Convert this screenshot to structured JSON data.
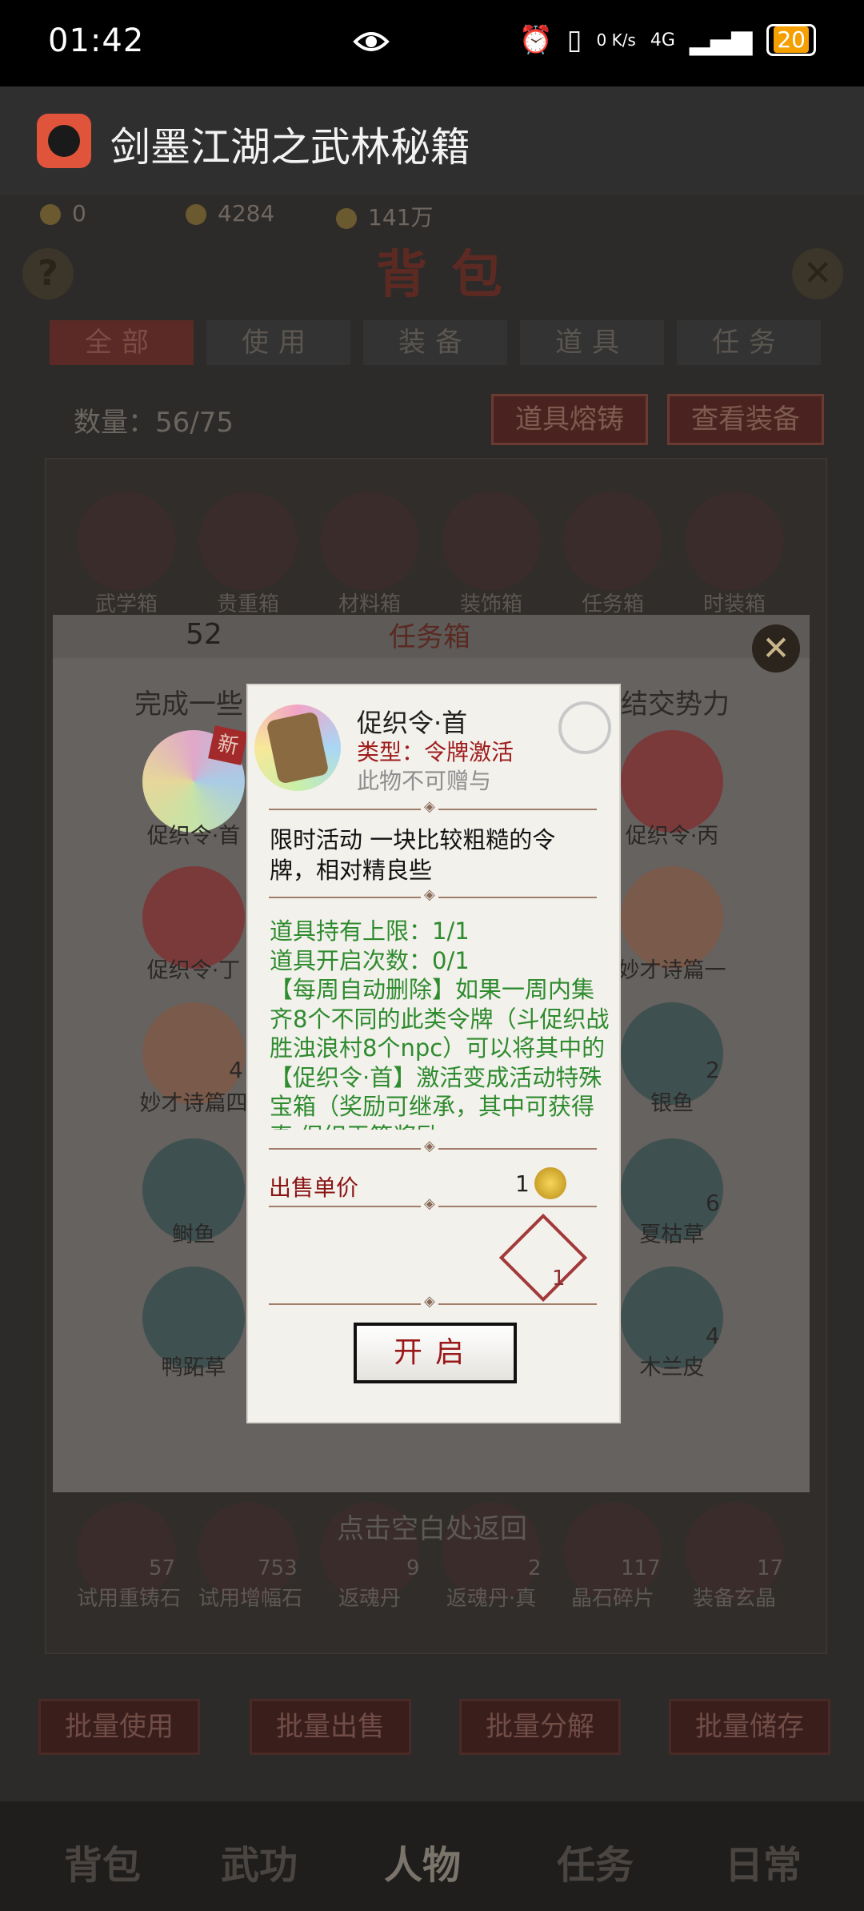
{
  "status_bar": {
    "time": "01:42",
    "net_speed": "0 K/s",
    "network": "4G",
    "battery": "20"
  },
  "app": {
    "title": "剑墨江湖之武林秘籍"
  },
  "resources": [
    "0",
    "4284",
    "141万"
  ],
  "bag": {
    "title": "背包",
    "tabs": [
      "全部",
      "使用",
      "装备",
      "道具",
      "任务"
    ],
    "count_text": "数量：56/75",
    "top_buttons": [
      "道具熔铸",
      "查看装备"
    ],
    "row1": [
      "武学箱",
      "贵重箱",
      "材料箱",
      "装饰箱",
      "任务箱",
      "时装箱"
    ],
    "row_bottom": [
      {
        "name": "试用重铸石",
        "count": "57"
      },
      {
        "name": "试用增幅石",
        "count": "753"
      },
      {
        "name": "返魂丹",
        "count": "9"
      },
      {
        "name": "返魂丹·真",
        "count": "2"
      },
      {
        "name": "晶石碎片",
        "count": "117"
      },
      {
        "name": "装备玄晶",
        "count": "17"
      }
    ],
    "batch_buttons": [
      "批量使用",
      "批量出售",
      "批量分解",
      "批量储存"
    ]
  },
  "nav": [
    "背包",
    "武功",
    "人物",
    "任务",
    "日常"
  ],
  "task_box": {
    "count": "52",
    "title": "任务箱",
    "desc_left": "完成一些",
    "desc_right": "结交势力",
    "items_left": [
      {
        "name": "促织令·首",
        "count": ""
      },
      {
        "name": "促织令·丁",
        "count": ""
      },
      {
        "name": "妙才诗篇四",
        "count": "4"
      },
      {
        "name": "鲥鱼",
        "count": ""
      },
      {
        "name": "鸭跖草",
        "count": ""
      }
    ],
    "items_right": [
      {
        "name": "促织令·丙",
        "count": ""
      },
      {
        "name": "妙才诗篇一",
        "count": ""
      },
      {
        "name": "银鱼",
        "count": "2"
      },
      {
        "name": "夏枯草",
        "count": "6"
      },
      {
        "name": "木兰皮",
        "count": "4"
      }
    ],
    "new_badge": "新",
    "hint": "点击空白处返回"
  },
  "detail": {
    "name": "促织令·首",
    "type": "类型：令牌激活",
    "giftable": "此物不可赠与",
    "description": "限时活动 一块比较粗糙的令牌，相对精良些",
    "hold_limit": "道具持有上限：1/1",
    "open_times": "道具开启次数：0/1",
    "weekly_note": "【每周自动删除】如果一周内集齐8个不同的此类令牌（斗促织战胜浊浪村8个npc）可以将其中的【促织令·首】激活变成活动特殊宝箱（奖励可继承，其中可获得真·促织王等奖励",
    "sell_label": "出售单价",
    "sell_price": "1",
    "give_count": "1",
    "open_button": "开启"
  },
  "colors": {
    "accent_red": "#9e1c1c",
    "green_text": "#2e8b2e",
    "battery": "#f5a000"
  }
}
